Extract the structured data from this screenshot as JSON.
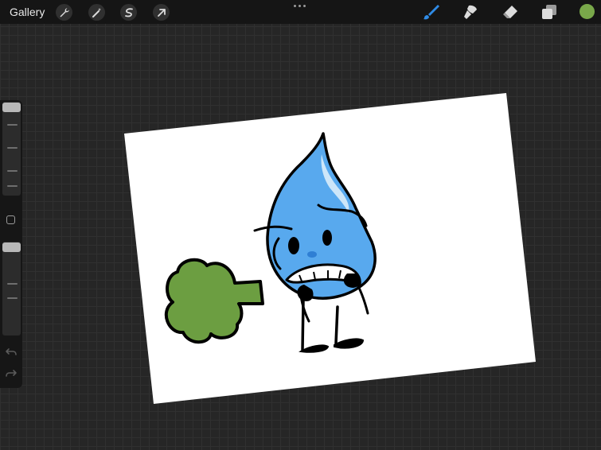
{
  "toolbar": {
    "gallery_label": "Gallery",
    "left_tools": [
      "wrench-icon",
      "magic-wand-icon",
      "selection-icon",
      "transform-arrow-icon"
    ],
    "right_tools": [
      "brush-icon",
      "smudge-icon",
      "eraser-icon",
      "layers-icon"
    ],
    "active_tool": "brush-icon",
    "current_color": "#79a84a",
    "brush_color": "#2f8be6"
  },
  "sidebar": {
    "brush_size_level": 1.0,
    "opacity_level": 1.0
  },
  "artwork": {
    "paper_color": "#ffffff",
    "drop_color": "#58a9ee",
    "drop_highlight": "#cde6f9",
    "cloud_color": "#6c9e41",
    "outline_color": "#000000"
  }
}
